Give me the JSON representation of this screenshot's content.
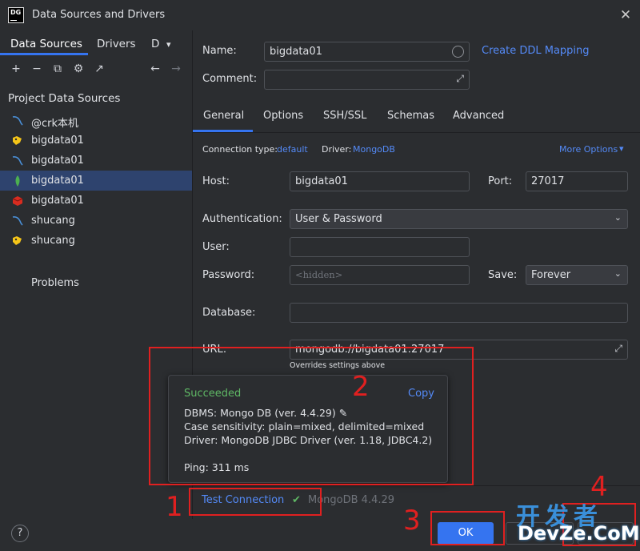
{
  "window": {
    "title": "Data Sources and Drivers",
    "app_icon": "datagrip-logo",
    "app_icon_text": "DG"
  },
  "left": {
    "tabs": [
      "Data Sources",
      "Drivers",
      "D"
    ],
    "toolbar_icons": [
      "add-icon",
      "remove-icon",
      "duplicate-icon",
      "settings-icon",
      "external-link-icon",
      "back-arrow-icon",
      "forward-arrow-icon"
    ],
    "section_title": "Project Data Sources",
    "items": [
      {
        "label": "@crk本机",
        "icon": "mysql-icon",
        "color": "#4a90d9"
      },
      {
        "label": "bigdata01",
        "icon": "hive-icon",
        "color": "#f5c518"
      },
      {
        "label": "bigdata01",
        "icon": "mysql-icon",
        "color": "#4a90d9"
      },
      {
        "label": "bigdata01",
        "icon": "mongodb-icon",
        "color": "#4caf50"
      },
      {
        "label": "bigdata01",
        "icon": "redis-icon",
        "color": "#d82c20"
      },
      {
        "label": "shucang",
        "icon": "mysql-icon",
        "color": "#4a90d9"
      },
      {
        "label": "shucang",
        "icon": "hive-icon",
        "color": "#f5c518"
      }
    ],
    "problems": "Problems"
  },
  "form": {
    "name_label": "Name:",
    "name_value": "bigdata01",
    "create_ddl": "Create DDL Mapping",
    "comment_label": "Comment:",
    "comment_value": "",
    "tabs": [
      "General",
      "Options",
      "SSH/SSL",
      "Schemas",
      "Advanced"
    ],
    "conn_type_label": "Connection type:",
    "conn_type_value": "default",
    "driver_label": "Driver:",
    "driver_value": "MongoDB",
    "more_options": "More Options",
    "host_label": "Host:",
    "host_value": "bigdata01",
    "port_label": "Port:",
    "port_value": "27017",
    "auth_label": "Authentication:",
    "auth_value": "User & Password",
    "user_label": "User:",
    "user_value": "",
    "password_label": "Password:",
    "password_placeholder": "<hidden>",
    "save_label": "Save:",
    "save_value": "Forever",
    "database_label": "Database:",
    "database_value": "",
    "url_label": "URL:",
    "url_value": "mongodb://bigdata01:27017",
    "url_hint": "Overrides settings above"
  },
  "popup": {
    "status": "Succeeded",
    "copy": "Copy",
    "dbms": "DBMS: Mongo DB (ver. 4.4.29)",
    "case": "Case sensitivity: plain=mixed, delimited=mixed",
    "driver": "Driver: MongoDB JDBC Driver (ver. 1.18, JDBC4.2)",
    "ping": "Ping: 311 ms"
  },
  "bottom": {
    "test_connection": "Test Connection",
    "test_result": "MongoDB 4.4.29",
    "help": "?",
    "ok": "OK"
  },
  "annotations": {
    "n1": "1",
    "n2": "2",
    "n3": "3",
    "n4": "4",
    "color": "#e02020"
  },
  "watermark": {
    "cn": "开发者",
    "en": "DevZe.CoM"
  },
  "colors": {
    "accent": "#3574f0",
    "link": "#548af7",
    "success": "#5fb865",
    "background": "#2b2d30"
  }
}
